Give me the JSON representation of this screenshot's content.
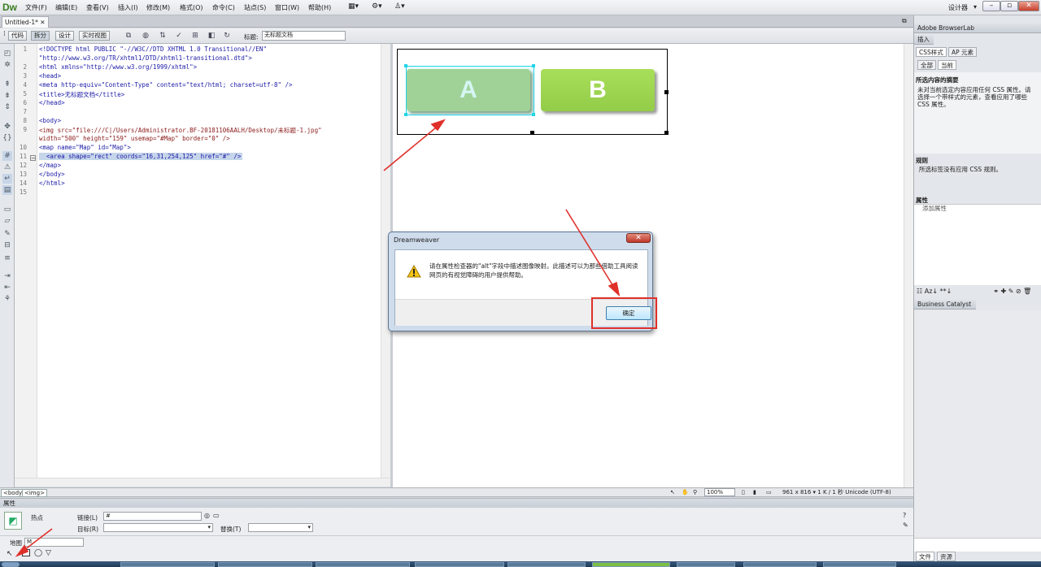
{
  "app": {
    "logo": "Dw",
    "menus": [
      "文件(F)",
      "编辑(E)",
      "查看(V)",
      "插入(I)",
      "修改(M)",
      "格式(O)",
      "命令(C)",
      "站点(S)",
      "窗口(W)",
      "帮助(H)"
    ],
    "workspace": "设计器",
    "doc_tab": "Untitled-1*"
  },
  "toolbar": {
    "views": [
      "代码",
      "拆分",
      "设计",
      "实时视图"
    ],
    "title_label": "标题:",
    "title_value": "无标题文档"
  },
  "code": {
    "line_numbers": [
      "1",
      "",
      "2",
      "3",
      "4",
      "5",
      "6",
      "7",
      "8",
      "9",
      "",
      "10",
      "11",
      "12",
      "13",
      "14",
      "15"
    ],
    "lines": [
      "<!DOCTYPE html PUBLIC \"-//W3C//DTD XHTML 1.0 Transitional//EN\"",
      "\"http://www.w3.org/TR/xhtml1/DTD/xhtml1-transitional.dtd\">",
      "<html xmlns=\"http://www.w3.org/1999/xhtml\">",
      "<head>",
      "<meta http-equiv=\"Content-Type\" content=\"text/html; charset=utf-8\" />",
      "<title>无标题文档</title>",
      "</head>",
      "",
      "<body>",
      "<img src=\"file:///C|/Users/Administrator.BF-20181106AALH/Desktop/未标题-1.jpg\"",
      "width=\"500\" height=\"159\" usemap=\"#Map\" border=\"0\" />",
      "<map name=\"Map\" id=\"Map\">",
      "  <area shape=\"rect\" coords=\"16,31,254,125\" href=\"#\" />",
      "</map>",
      "</body>",
      "</html>",
      ""
    ]
  },
  "design": {
    "button_a": "A",
    "button_b": "B"
  },
  "dialog": {
    "title": "Dreamweaver",
    "close": "✕",
    "message": "请在属性检查器的\"alt\"字段中描述图像映射。此描述可以为那些借助工具阅读网页的有视觉障碍的用户提供帮助。",
    "ok": "确定"
  },
  "status": {
    "tags": [
      "<body>",
      "<img>"
    ],
    "zoom": "100%",
    "info": "961 x 816 ▾ 1 K / 1 秒 Unicode (UTF-8)"
  },
  "properties": {
    "header": "属性",
    "type": "热点",
    "link_label": "链接(L)",
    "link_value": "#",
    "target_label": "目标(R)",
    "target_value": "",
    "alt_label": "替换(T)",
    "alt_value": "",
    "map_label": "地图",
    "map_value": "M"
  },
  "right": {
    "browserlab": "Adobe BrowserLab",
    "insert": "插入",
    "css_tab": "CSS样式",
    "ap_tab": "AP 元素",
    "all": "全部",
    "current": "当前",
    "summary_title": "所选内容的摘要",
    "summary_text": "未对当前选定内容应用任何 CSS 属性。请选择一个带样式的元素，查看应用了哪些 CSS 属性。",
    "rules_title": "规则",
    "rules_text": "所选标签没有应用 CSS 规则。",
    "attrs_title": "属性",
    "add_attr": "添加属性",
    "business": "Business Catalyst",
    "files": "文件",
    "assets": "资源"
  }
}
